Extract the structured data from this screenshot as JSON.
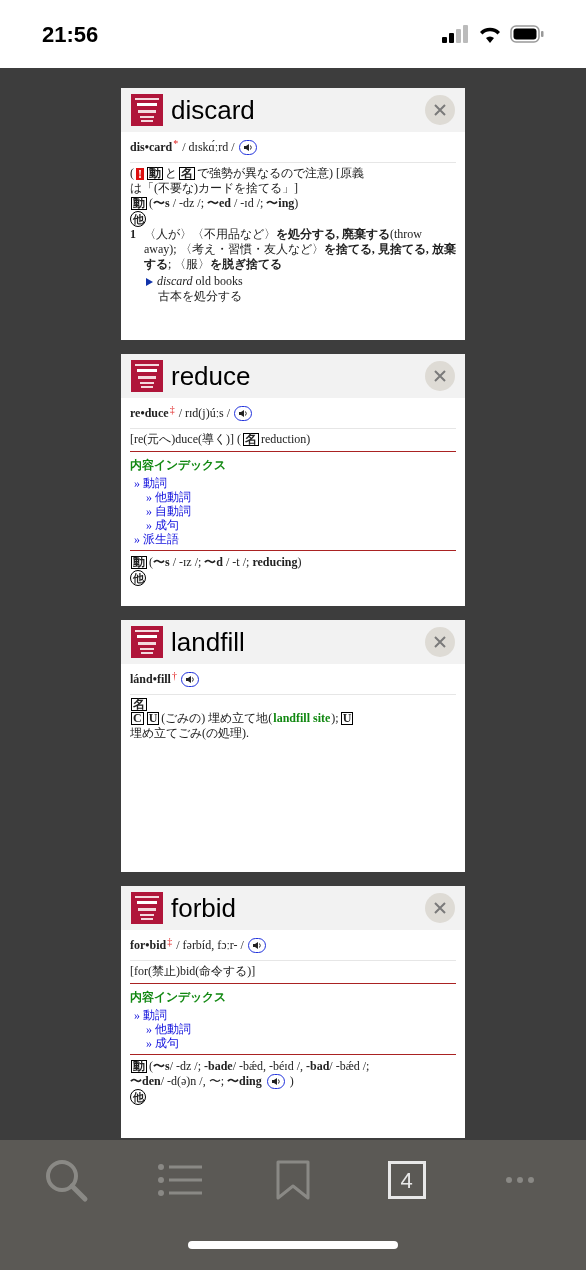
{
  "status_bar": {
    "time": "21:56"
  },
  "cards": [
    {
      "title": "discard",
      "headword": {
        "word": "dis•card",
        "mark": "*",
        "pron": "/ dɪskɑ́ːrd /",
        "audio": true
      },
      "blocks": [
        {
          "kind": "para",
          "parts": [
            {
              "kind": "text",
              "text": "("
            },
            {
              "kind": "alert",
              "text": "!"
            },
            {
              "kind": "box",
              "text": "動"
            },
            {
              "kind": "text",
              "text": "と"
            },
            {
              "kind": "box",
              "text": "名"
            },
            {
              "kind": "text",
              "text": "で強勢が異なるので注意) [原義"
            },
            {
              "kind": "line",
              "text": "は「(不要な)カードを捨てる」]"
            }
          ]
        },
        {
          "kind": "para",
          "parts": [
            {
              "kind": "box",
              "text": "動"
            },
            {
              "kind": "text",
              "text": " (**〜s** / -dz /; **〜ed** / -ɪd /; **〜ing**)"
            }
          ]
        },
        {
          "kind": "para",
          "parts": [
            {
              "kind": "circle",
              "text": "他"
            }
          ]
        },
        {
          "kind": "sense",
          "number": "1",
          "text": "〈人が〉〈不用品など〉**を処分する, 廃棄する**(throw away); 〈考え・習慣・友人など〉**を捨てる, 見捨てる, 放棄する**; 〈服〉**を脱ぎ捨てる**"
        },
        {
          "kind": "example",
          "en": "*discard* old books",
          "ja": "古本を処分する"
        }
      ]
    },
    {
      "title": "reduce",
      "headword": {
        "word": "re•duce",
        "mark": "‡",
        "pron": "/ rɪd(j)úːs /",
        "audio": true
      },
      "blocks": [
        {
          "kind": "para",
          "parts": [
            {
              "kind": "text",
              "text": "[re(元へ)duce(導く)] ("
            },
            {
              "kind": "box",
              "text": "名"
            },
            {
              "kind": "text",
              "text": " reduction)"
            }
          ]
        },
        {
          "kind": "index",
          "heading": "内容インデックス",
          "items": [
            {
              "label": "» 動詞",
              "children": [
                {
                  "label": "» 他動詞"
                },
                {
                  "label": "» 自動詞"
                },
                {
                  "label": "» 成句"
                }
              ]
            },
            {
              "label": "» 派生語"
            }
          ]
        },
        {
          "kind": "para",
          "parts": [
            {
              "kind": "box",
              "text": "動"
            },
            {
              "kind": "text",
              "text": " (**〜s** / -ɪz /; **〜d** / -t /; **reducing**)"
            }
          ]
        },
        {
          "kind": "para",
          "parts": [
            {
              "kind": "circle",
              "text": "他"
            }
          ]
        }
      ]
    },
    {
      "title": "landfill",
      "headword": {
        "word": "lánd•fill",
        "mark": "†",
        "audio": true
      },
      "blocks": [
        {
          "kind": "para",
          "parts": [
            {
              "kind": "box",
              "text": "名"
            }
          ]
        },
        {
          "kind": "para",
          "parts": [
            {
              "kind": "box",
              "text": "C"
            },
            {
              "kind": "box",
              "text": "U"
            },
            {
              "kind": "text",
              "text": " (ごみの) 埋め立て地("
            },
            {
              "kind": "term",
              "text": "landfill site"
            },
            {
              "kind": "text",
              "text": "); "
            },
            {
              "kind": "box",
              "text": "U"
            },
            {
              "kind": "text",
              "text": " 埋め立てごみ(の処理)."
            }
          ]
        }
      ]
    },
    {
      "title": "forbid",
      "headword": {
        "word": "for•bid",
        "mark": "‡",
        "pron": "/ fərbíd, fɔːr- /",
        "audio": true
      },
      "blocks": [
        {
          "kind": "para",
          "parts": [
            {
              "kind": "text",
              "text": "[for(禁止)bid(命令する)]"
            }
          ]
        },
        {
          "kind": "index",
          "heading": "内容インデックス",
          "items": [
            {
              "label": "» 動詞",
              "children": [
                {
                  "label": "» 他動詞"
                },
                {
                  "label": "» 成句"
                }
              ]
            }
          ]
        },
        {
          "kind": "para",
          "parts": [
            {
              "kind": "box",
              "text": "動"
            },
            {
              "kind": "text",
              "text": " (**〜s**/ -dz /; **-bade**/ -bǽd, -béɪd /, **-bad**/ -bǽd /;"
            },
            {
              "kind": "line",
              "text": "**〜den**/ -d(ə)n /, 〜; **〜ding**"
            },
            {
              "kind": "audio"
            },
            {
              "kind": "text",
              "text": ")"
            }
          ]
        },
        {
          "kind": "para",
          "parts": [
            {
              "kind": "circle",
              "text": "他"
            }
          ]
        }
      ]
    }
  ],
  "tab_bar": [
    {
      "kind": "search",
      "selected": false
    },
    {
      "kind": "list",
      "selected": false
    },
    {
      "kind": "bookmark",
      "selected": false
    },
    {
      "kind": "count",
      "text": "4",
      "selected": true
    },
    {
      "kind": "more",
      "selected": false
    }
  ]
}
